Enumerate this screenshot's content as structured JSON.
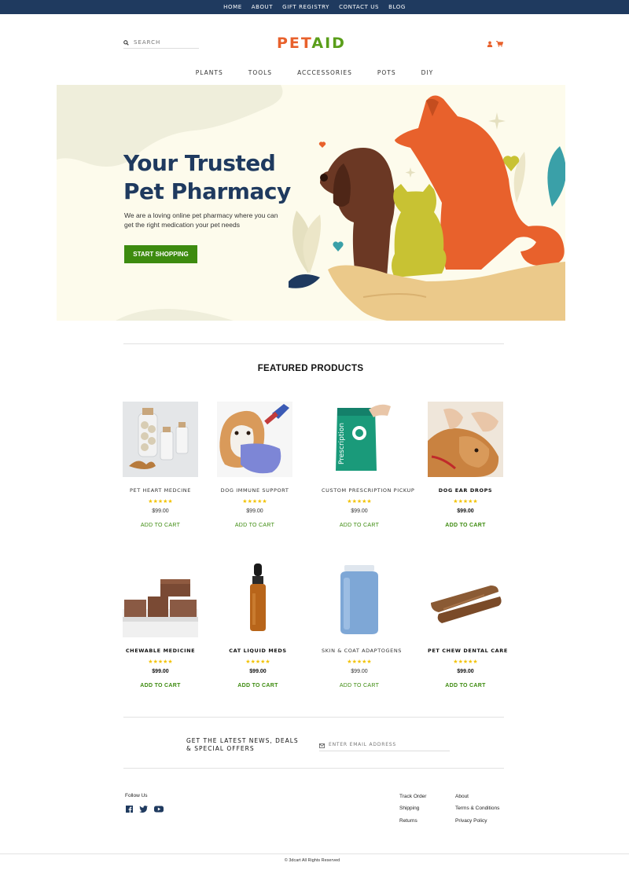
{
  "topnav": [
    "HOME",
    "ABOUT",
    "GIFT REGISTRY",
    "CONTACT US",
    "BLOG"
  ],
  "search": {
    "placeholder": "SEARCH"
  },
  "brand": {
    "part1": "PET",
    "part2": "AID"
  },
  "categories": [
    "PLANTS",
    "TOOLS",
    "ACCCESSORIES",
    "POTS",
    "DIY"
  ],
  "hero": {
    "title_line1": "Your Trusted",
    "title_line2": "Pet Pharmacy",
    "subtitle": "We are a loving online pet pharmacy where you can get the right medication your pet needs",
    "cta": "START SHOPPING"
  },
  "featured_title": "FEATURED PRODUCTS",
  "stars": "★★★★★",
  "products": [
    {
      "name": "PET HEART MEDCINE",
      "price": "$99.00",
      "cart": "ADD TO CART"
    },
    {
      "name": "DOG IMMUNE SUPPORT",
      "price": "$99.00",
      "cart": "ADD TO CART"
    },
    {
      "name": "CUSTOM PRESCRIPTION PICKUP",
      "price": "$99.00",
      "cart": "ADD TO CART"
    },
    {
      "name": "DOG EAR DROPS",
      "price": "$99.00",
      "cart": "ADD TO CART"
    },
    {
      "name": "CHEWABLE MEDICINE",
      "price": "$99.00",
      "cart": "ADD TO CART"
    },
    {
      "name": "CAT LIQUID MEDS",
      "price": "$99.00",
      "cart": "ADD TO CART"
    },
    {
      "name": "SKIN & COAT ADAPTOGENS",
      "price": "$99.00",
      "cart": "ADD TO CART"
    },
    {
      "name": "PET CHEW DENTAL CARE",
      "price": "$99.00",
      "cart": "ADD TO CART"
    }
  ],
  "newsletter": {
    "line1": "GET THE LATEST NEWS, DEALS",
    "line2": "& SPECIAL OFFERS",
    "placeholder": "ENTER EMAIL ADDRESS"
  },
  "footer": {
    "follow": "Follow Us",
    "col1": [
      "Track Order",
      "Shipping",
      "Returns"
    ],
    "col2": [
      "About",
      "Terms & Conditions",
      "Privacy Policy"
    ],
    "copyright": "© 3dcart All Rights Reserved"
  },
  "colors": {
    "navy": "#1f3a5f",
    "green": "#3d8b0f",
    "orange": "#e8612c",
    "star": "#f2c200"
  }
}
